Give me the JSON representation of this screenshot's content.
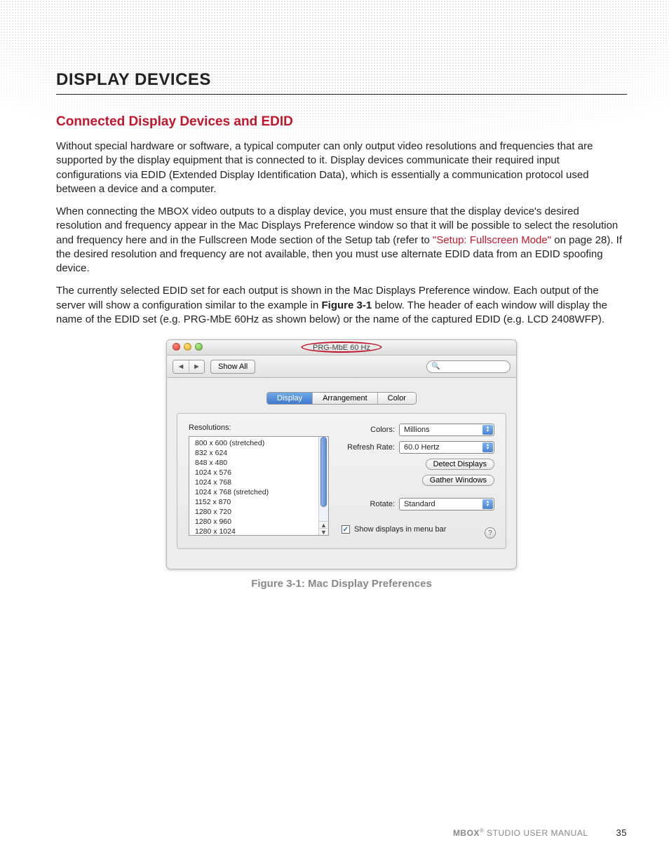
{
  "section_title": "DISPLAY DEVICES",
  "subsection_title": "Connected Display Devices and EDID",
  "para1": "Without special hardware or software, a typical computer can only output video resolutions and frequencies that are supported by the display equipment that is connected to it. Display devices communicate their required input configurations via EDID (Extended Display Identification Data), which is essentially a communication protocol used between a device and a computer.",
  "para2_a": "When connecting the MBOX video outputs to a display device, you must ensure that the display device's desired resolution and frequency appear in the Mac Displays Preference window so that it will be possible to select the resolution and frequency here and in the Fullscreen Mode section of the Setup tab (refer to ",
  "para2_link": "\"Setup: Fullscreen Mode\"",
  "para2_b": " on page 28). If the desired resolution and frequency are not available, then you must use alternate EDID data from an EDID spoofing device.",
  "para3_a": "The currently selected EDID set for each output is shown in the Mac Displays Preference window. Each output of the server will show a configuration similar to the example in ",
  "para3_fig": "Figure 3-1",
  "para3_b": " below. The header of each window will display the name of the EDID set (e.g. PRG-MbE 60Hz as shown below) or the name of the captured EDID (e.g. LCD 2408WFP).",
  "window": {
    "title": "PRG-MbE 60 Hz",
    "show_all": "Show All",
    "search_placeholder": "",
    "tabs": [
      "Display",
      "Arrangement",
      "Color"
    ],
    "active_tab": 0,
    "resolutions_label": "Resolutions:",
    "resolutions": [
      "800 x 600 (stretched)",
      "832 x 624",
      "848 x 480",
      "1024 x 576",
      "1024 x 768",
      "1024 x 768 (stretched)",
      "1152 x 870",
      "1280 x 720",
      "1280 x 960",
      "1280 x 1024"
    ],
    "colors_label": "Colors:",
    "colors_value": "Millions",
    "refresh_label": "Refresh Rate:",
    "refresh_value": "60.0 Hertz",
    "detect_btn": "Detect Displays",
    "gather_btn": "Gather Windows",
    "rotate_label": "Rotate:",
    "rotate_value": "Standard",
    "menubar_check": "Show displays in menu bar",
    "menubar_checked": true
  },
  "figure_caption": "Figure 3-1:  Mac Display Preferences",
  "footer": {
    "product": "MBOX",
    "reg": "®",
    "rest": " STUDIO USER MANUAL",
    "page": "35"
  }
}
